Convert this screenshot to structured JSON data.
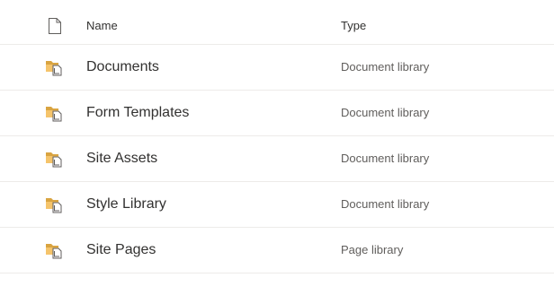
{
  "header": {
    "file_icon": "document-icon",
    "name_label": "Name",
    "type_label": "Type"
  },
  "items": [
    {
      "name": "Documents",
      "type": "Document library",
      "icon": "library-folder-icon"
    },
    {
      "name": "Form Templates",
      "type": "Document library",
      "icon": "library-folder-icon"
    },
    {
      "name": "Site Assets",
      "type": "Document library",
      "icon": "library-folder-icon"
    },
    {
      "name": "Style Library",
      "type": "Document library",
      "icon": "library-folder-icon"
    },
    {
      "name": "Site Pages",
      "type": "Page library",
      "icon": "library-folder-icon"
    }
  ],
  "colors": {
    "folder_back": "#d9a441",
    "folder_front": "#f5c46b",
    "doc_badge": "#ffffff",
    "text_primary": "#323130",
    "text_secondary": "#605e5c",
    "divider": "#edebe9"
  }
}
